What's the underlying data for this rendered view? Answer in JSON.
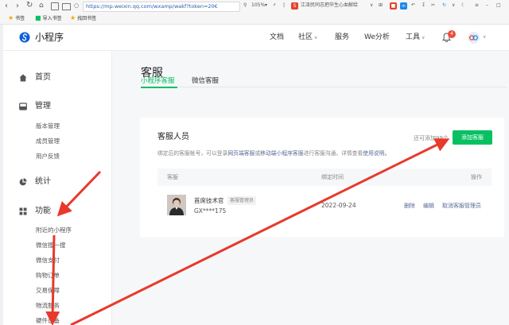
{
  "browser": {
    "url": "https://mp.weixin.qq.com/wxamp/wakf?token=20€",
    "zoom": "105%",
    "news_ticker": "江泽民同志把毕生心血献给",
    "bookmarks": [
      "书签",
      "导入书签",
      "找回书签"
    ]
  },
  "app": {
    "title": "小程序",
    "nav": {
      "docs": "文档",
      "community": "社区",
      "services": "服务",
      "analytics": "We分析",
      "tools": "工具"
    },
    "notification_count": "4"
  },
  "sidebar": {
    "home": "首页",
    "manage": "管理",
    "manage_items": [
      "版本管理",
      "成员管理",
      "用户反馈"
    ],
    "stats": "统计",
    "features": "功能",
    "feature_items": [
      "附近的小程序",
      "微信搜一搜",
      "微信支付",
      "购物订单",
      "交易保障",
      "物流服务",
      "硬件设备"
    ]
  },
  "page": {
    "title": "客服",
    "tabs": [
      "小程序客服",
      "微信客服"
    ],
    "section_title": "客服人员",
    "quota": "还可添加99个",
    "add_button": "添加客服",
    "description_prefix": "绑定后的客服帐号，可以登录",
    "web_kf_link": "网页端客服",
    "or": "或",
    "mobile_kf_link": "移动端小程序客服",
    "description_suffix": "进行客服沟通。详情查看",
    "help_link": "使用说明。",
    "table": {
      "headers": {
        "agent": "客服",
        "bind_time": "绑定时间",
        "actions": "操作"
      },
      "rows": [
        {
          "name": "首席技术官",
          "role": "客服管理员",
          "account": "GX****175",
          "bind_time": "2022-09-24",
          "actions": [
            "删除",
            "编辑",
            "取消客服管理员"
          ]
        }
      ]
    }
  },
  "colors": {
    "green": "#07c160",
    "link": "#576b95",
    "arrow": "#e8392b"
  }
}
